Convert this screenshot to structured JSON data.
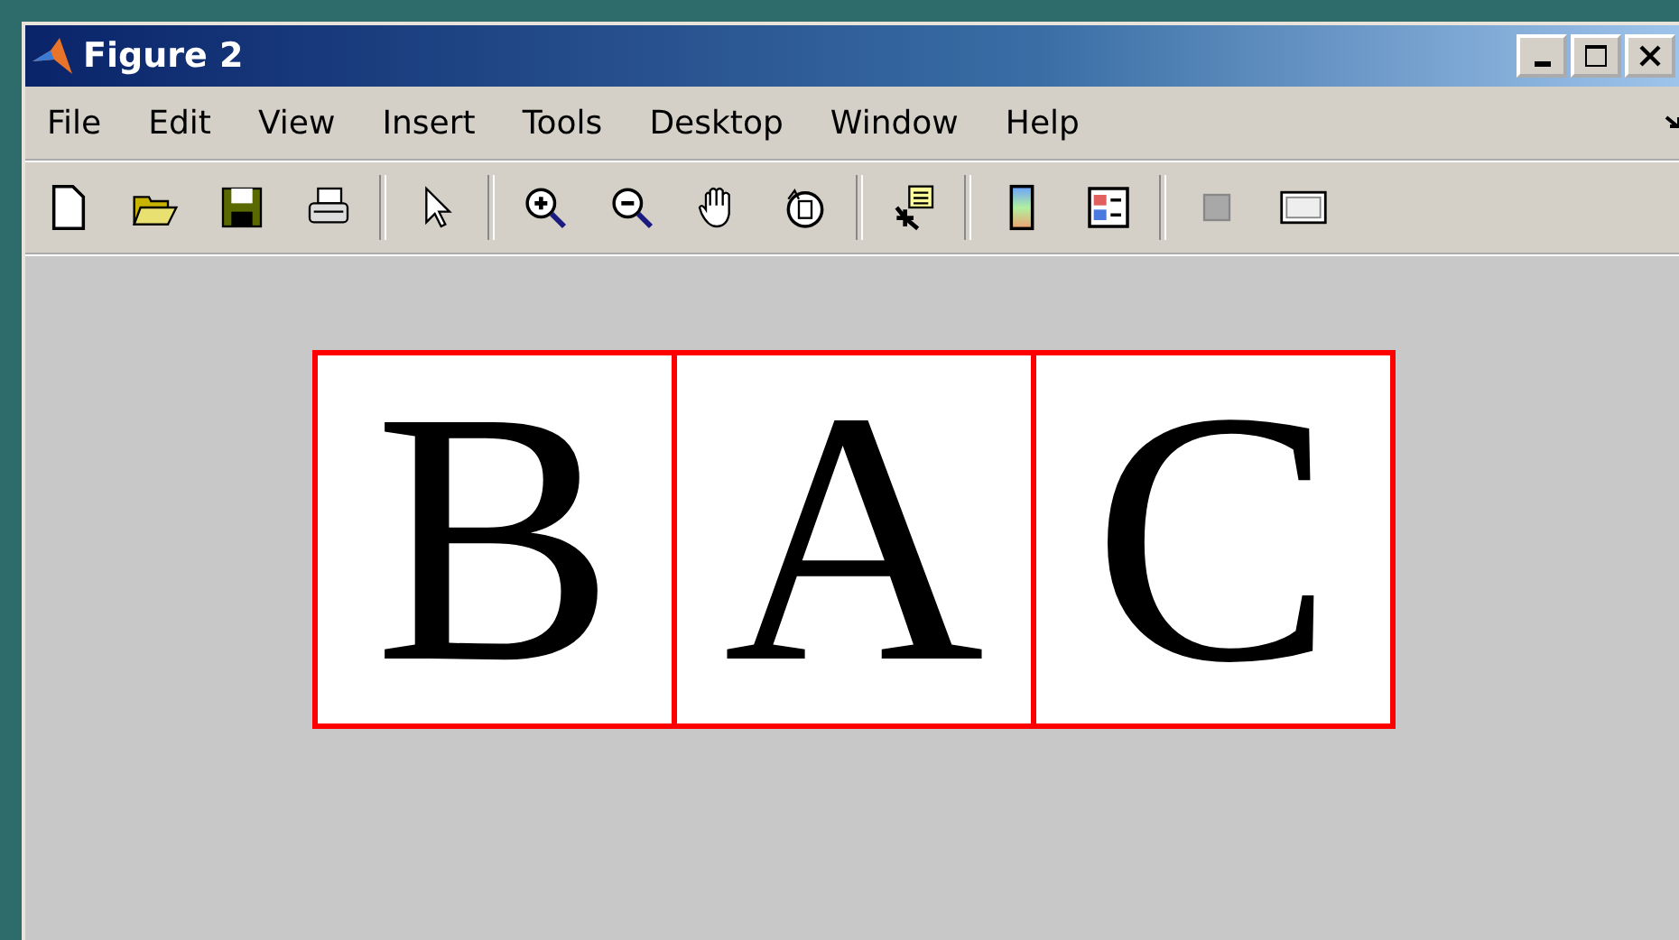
{
  "window": {
    "title": "Figure 2"
  },
  "menu": [
    "File",
    "Edit",
    "View",
    "Insert",
    "Tools",
    "Desktop",
    "Window",
    "Help"
  ],
  "panels": [
    {
      "letter": "B"
    },
    {
      "letter": "A"
    },
    {
      "letter": "C"
    }
  ]
}
